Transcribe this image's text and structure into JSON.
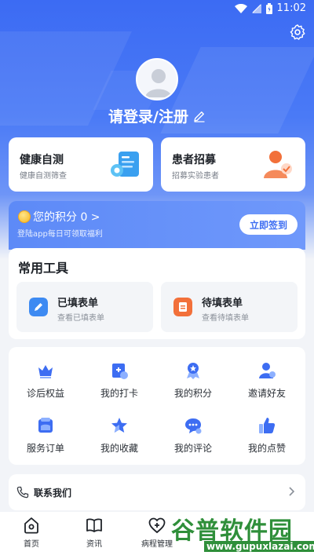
{
  "status_bar": {
    "time": "11:02"
  },
  "user": {
    "login_label": "请登录/注册"
  },
  "quick_cards": [
    {
      "title": "健康自测",
      "subtitle": "健康自测筛查"
    },
    {
      "title": "患者招募",
      "subtitle": "招募实验患者"
    }
  ],
  "points": {
    "label": "您的积分 0 >",
    "subtitle": "登陆app每日可领取福利",
    "button": "立即签到"
  },
  "tools": {
    "title": "常用工具",
    "items": [
      {
        "title": "已填表单",
        "subtitle": "查看已填表单"
      },
      {
        "title": "待填表单",
        "subtitle": "查看待填表单"
      }
    ]
  },
  "grid": {
    "items": [
      {
        "label": "诊后权益"
      },
      {
        "label": "我的打卡"
      },
      {
        "label": "我的积分"
      },
      {
        "label": "邀请好友"
      },
      {
        "label": "服务订单"
      },
      {
        "label": "我的收藏"
      },
      {
        "label": "我的评论"
      },
      {
        "label": "我的点赞"
      }
    ]
  },
  "contact": {
    "label": "联系我们"
  },
  "tabbar": {
    "items": [
      {
        "label": "首页"
      },
      {
        "label": "资讯"
      },
      {
        "label": "病程管理"
      }
    ]
  },
  "watermark": {
    "text": "谷普软件园",
    "url": "www.gupuxlazai.com"
  },
  "colors": {
    "primary": "#3d6df2",
    "accent_orange": "#f2703a",
    "watermark_green": "#2f8f3a"
  }
}
